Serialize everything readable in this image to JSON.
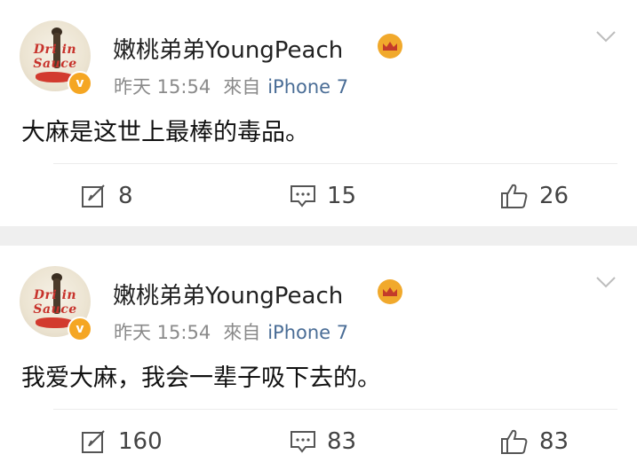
{
  "posts": [
    {
      "username": "嫩桃弟弟YoungPeach",
      "time": "昨天 15:54",
      "source_prefix": "來自",
      "device": "iPhone 7",
      "content": "大麻是这世上最棒的毒品。",
      "reposts": "8",
      "comments": "15",
      "likes": "26",
      "avatar_text": [
        "Dri in",
        "Sauce"
      ]
    },
    {
      "username": "嫩桃弟弟YoungPeach",
      "time": "昨天 15:54",
      "source_prefix": "來自",
      "device": "iPhone 7",
      "content": "我爱大麻，我会一辈子吸下去的。",
      "reposts": "160",
      "comments": "83",
      "likes": "83",
      "avatar_text": [
        "Dri in",
        "Sauce"
      ]
    }
  ],
  "icons": {
    "verified": "verified-v-icon",
    "member": "crown-icon",
    "menu": "chevron-down-icon",
    "repost": "repost-icon",
    "comment": "comment-icon",
    "like": "thumbs-up-icon"
  },
  "colors": {
    "link": "#4a6d96",
    "verified_badge": "#f5a623",
    "separator": "#efefef"
  }
}
